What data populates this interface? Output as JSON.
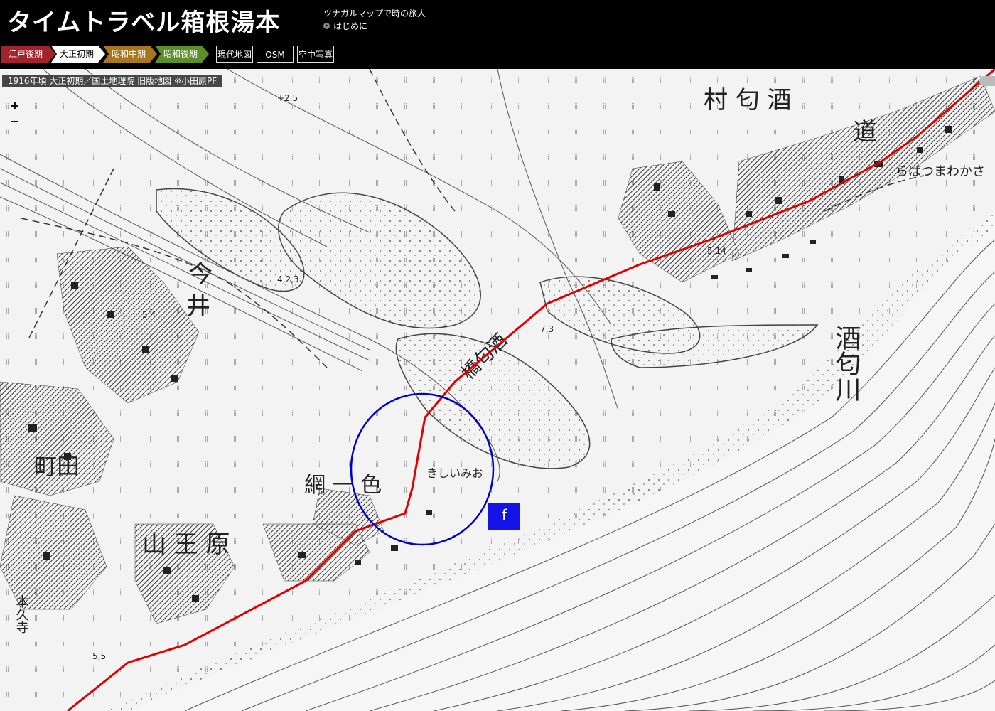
{
  "header": {
    "title": "タイムトラベル箱根湯本",
    "tagline": "ツナガルマップで時の旅人",
    "intro_link": "はじめに"
  },
  "eras": [
    {
      "label": "江戸後期",
      "color": "#a3222b",
      "text_color": "#ffffff",
      "selected": false
    },
    {
      "label": "大正初期",
      "color": "#ffffff",
      "text_color": "#000000",
      "selected": true
    },
    {
      "label": "昭和中期",
      "color": "#a8761c",
      "text_color": "#ffffff",
      "selected": false
    },
    {
      "label": "昭和後期",
      "color": "#5c8f2a",
      "text_color": "#ffffff",
      "selected": false
    }
  ],
  "map_types": [
    "現代地図",
    "OSM",
    "空中写真"
  ],
  "map": {
    "caption": "1916年頃 大正初期／国土地理院 旧版地図 ※小田原PF",
    "zoom_in": "+",
    "zoom_out": "−",
    "marker_label": "f",
    "labels": {
      "village": "村 匂 酒",
      "road": "道",
      "place_right": "らばつまわかさ",
      "river": "酒匂川",
      "bridge": "橋匂酒",
      "town_left": "町田",
      "ima": "今",
      "i": "井",
      "amiisshiki": "網 一 色",
      "kishii": "きしいみお",
      "sannohara": "山 王 原",
      "honkuji": "本久寺",
      "elev1": "5,14",
      "elev2": "4,2,3",
      "elev3": "7,3",
      "elev4": "5,4",
      "elev5": "+2,5",
      "elev6": "5,5"
    },
    "route_color": "#e00000",
    "circle_color": "#0000cc"
  }
}
